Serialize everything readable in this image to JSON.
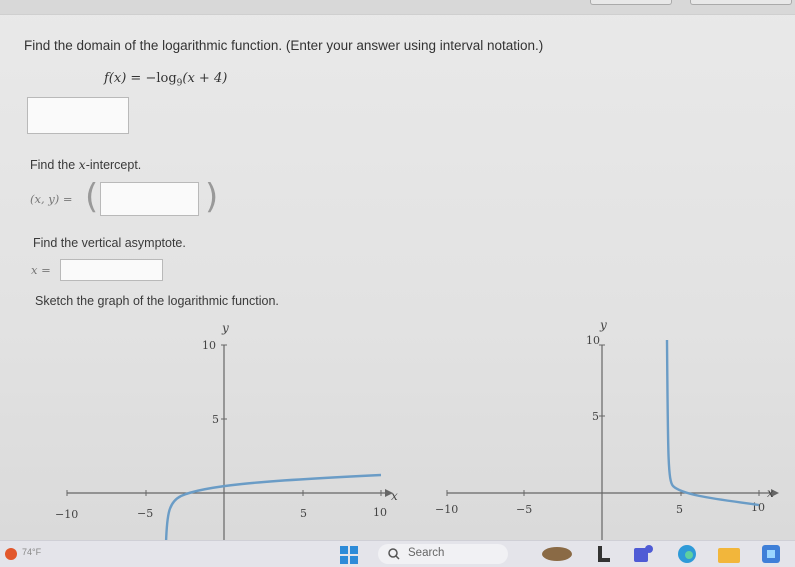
{
  "question": {
    "prompt": "Find the domain of the logarithmic function. (Enter your answer using interval notation.)",
    "function_lhs": "f(x) = ",
    "function_minus": "−log",
    "function_base": "9",
    "function_arg": "(x + 4)"
  },
  "domain_input": {
    "value": ""
  },
  "x_intercept": {
    "label_prefix": "Find the ",
    "label_var": "x",
    "label_suffix": "-intercept.",
    "pair_label": "(x, y) =",
    "open_paren": "(",
    "close_paren": ")",
    "value": ""
  },
  "asymptote": {
    "label": "Find the vertical asymptote.",
    "eq_label": "x =",
    "value": ""
  },
  "sketch": {
    "label": "Sketch the graph of the logarithmic function."
  },
  "graphs": {
    "left": {
      "y_axis_label": "y",
      "x_axis_label": "x",
      "ticks": {
        "y10": "10",
        "y5": "5",
        "xm10": "−10",
        "xm5": "−5",
        "x5": "5",
        "x10": "10"
      }
    },
    "right": {
      "y_axis_label": "y",
      "x_axis_label": "x",
      "ticks": {
        "y10": "10",
        "y5": "5",
        "xm10": "−10",
        "xm5": "−5",
        "x5": "5",
        "x10": "10"
      }
    }
  },
  "colors": {
    "curve": "#6a9cc6",
    "axis": "#555555"
  },
  "taskbar": {
    "weather": "74°F",
    "search_label": "Search"
  }
}
